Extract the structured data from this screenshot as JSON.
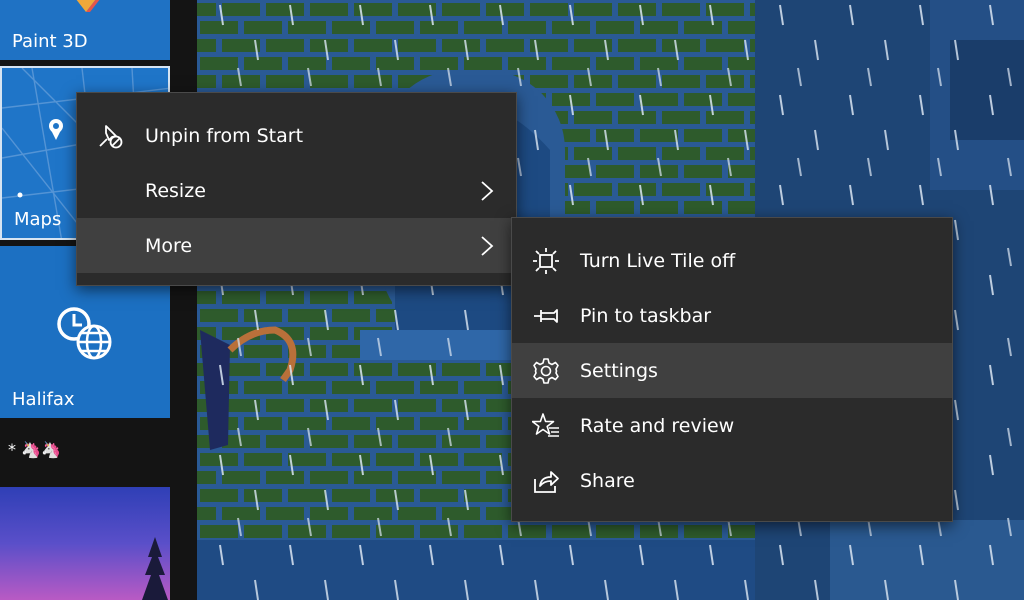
{
  "tiles": [
    {
      "label": "Paint 3D"
    },
    {
      "label": "Maps"
    },
    {
      "label": "Halifax"
    }
  ],
  "group": {
    "title": "* 🦄🦄"
  },
  "context_menu": {
    "items": [
      {
        "label": "Unpin from Start",
        "icon": "unpin-icon"
      },
      {
        "label": "Resize",
        "icon": "",
        "has_submenu": true
      },
      {
        "label": "More",
        "icon": "",
        "has_submenu": true,
        "highlighted": true
      }
    ]
  },
  "submenu": {
    "items": [
      {
        "label": "Turn Live Tile off",
        "icon": "live-tile-icon"
      },
      {
        "label": "Pin to taskbar",
        "icon": "pin-icon"
      },
      {
        "label": "Settings",
        "icon": "gear-icon",
        "highlighted": true
      },
      {
        "label": "Rate and review",
        "icon": "star-icon"
      },
      {
        "label": "Share",
        "icon": "share-icon"
      }
    ]
  },
  "colors": {
    "menu_bg": "#2b2b2b",
    "menu_hover": "#404040",
    "tile_blue": "#1f72c4",
    "wallpaper_blue": "#2a5a95",
    "brick_green": "#2e5b2c"
  }
}
